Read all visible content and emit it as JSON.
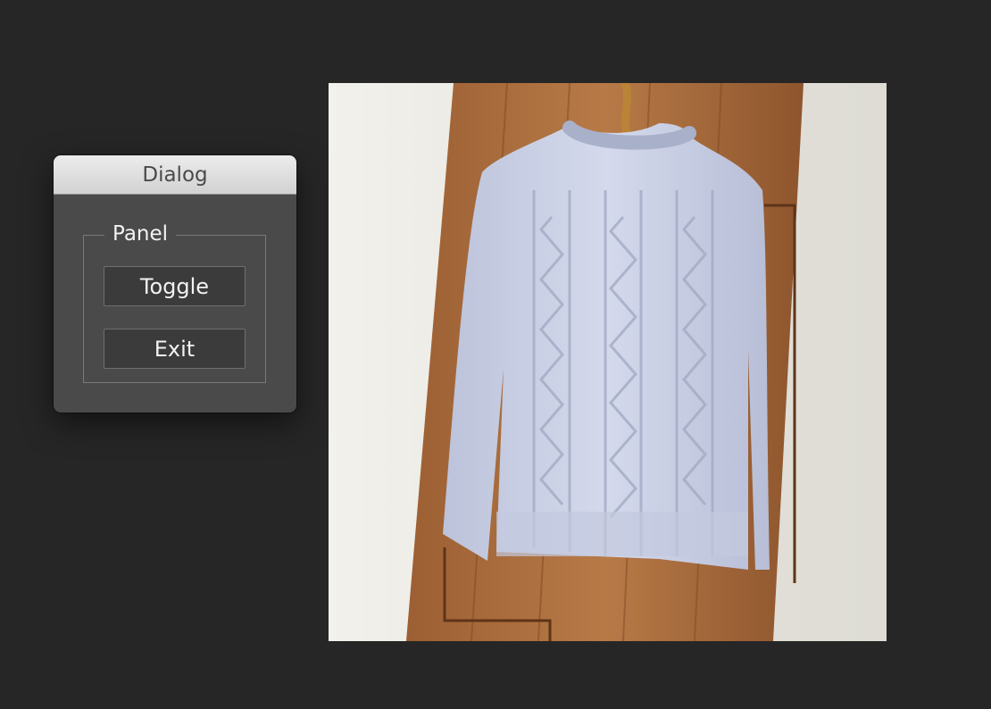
{
  "dialog": {
    "title": "Dialog",
    "panel_label": "Panel",
    "buttons": {
      "toggle_label": "Toggle",
      "exit_label": "Exit"
    }
  },
  "photo": {
    "subject": "cable-knit-sweater-on-hanger",
    "colors": {
      "wall": "#eceae5",
      "wood": "#a86b3c",
      "sweater": "#c9cfe4",
      "rope": "#c08a3e"
    }
  }
}
